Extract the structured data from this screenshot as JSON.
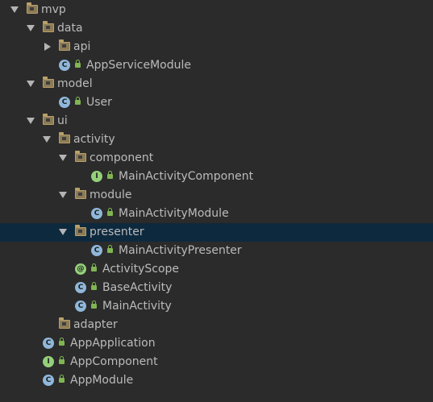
{
  "colors": {
    "background": "#2b2b2b",
    "selection": "#0d293e",
    "text": "#bbbbbb",
    "folder": "#b8a06a",
    "class_icon": "#8fb7da",
    "interface_icon": "#94cf7a",
    "access_icon": "#7fb552"
  },
  "tree": {
    "mvp": "mvp",
    "data": "data",
    "api": "api",
    "app_service_module": "AppServiceModule",
    "model": "model",
    "user": "User",
    "ui": "ui",
    "activity": "activity",
    "component": "component",
    "main_activity_component": "MainActivityComponent",
    "module": "module",
    "main_activity_module": "MainActivityModule",
    "presenter": "presenter",
    "main_activity_presenter": "MainActivityPresenter",
    "activity_scope": "ActivityScope",
    "base_activity": "BaseActivity",
    "main_activity": "MainActivity",
    "adapter": "adapter",
    "app_application": "AppApplication",
    "app_component": "AppComponent",
    "app_module": "AppModule"
  },
  "icons": {
    "class": "C",
    "interface": "I",
    "annotation": "@",
    "abstract": "C"
  },
  "selected": "presenter"
}
